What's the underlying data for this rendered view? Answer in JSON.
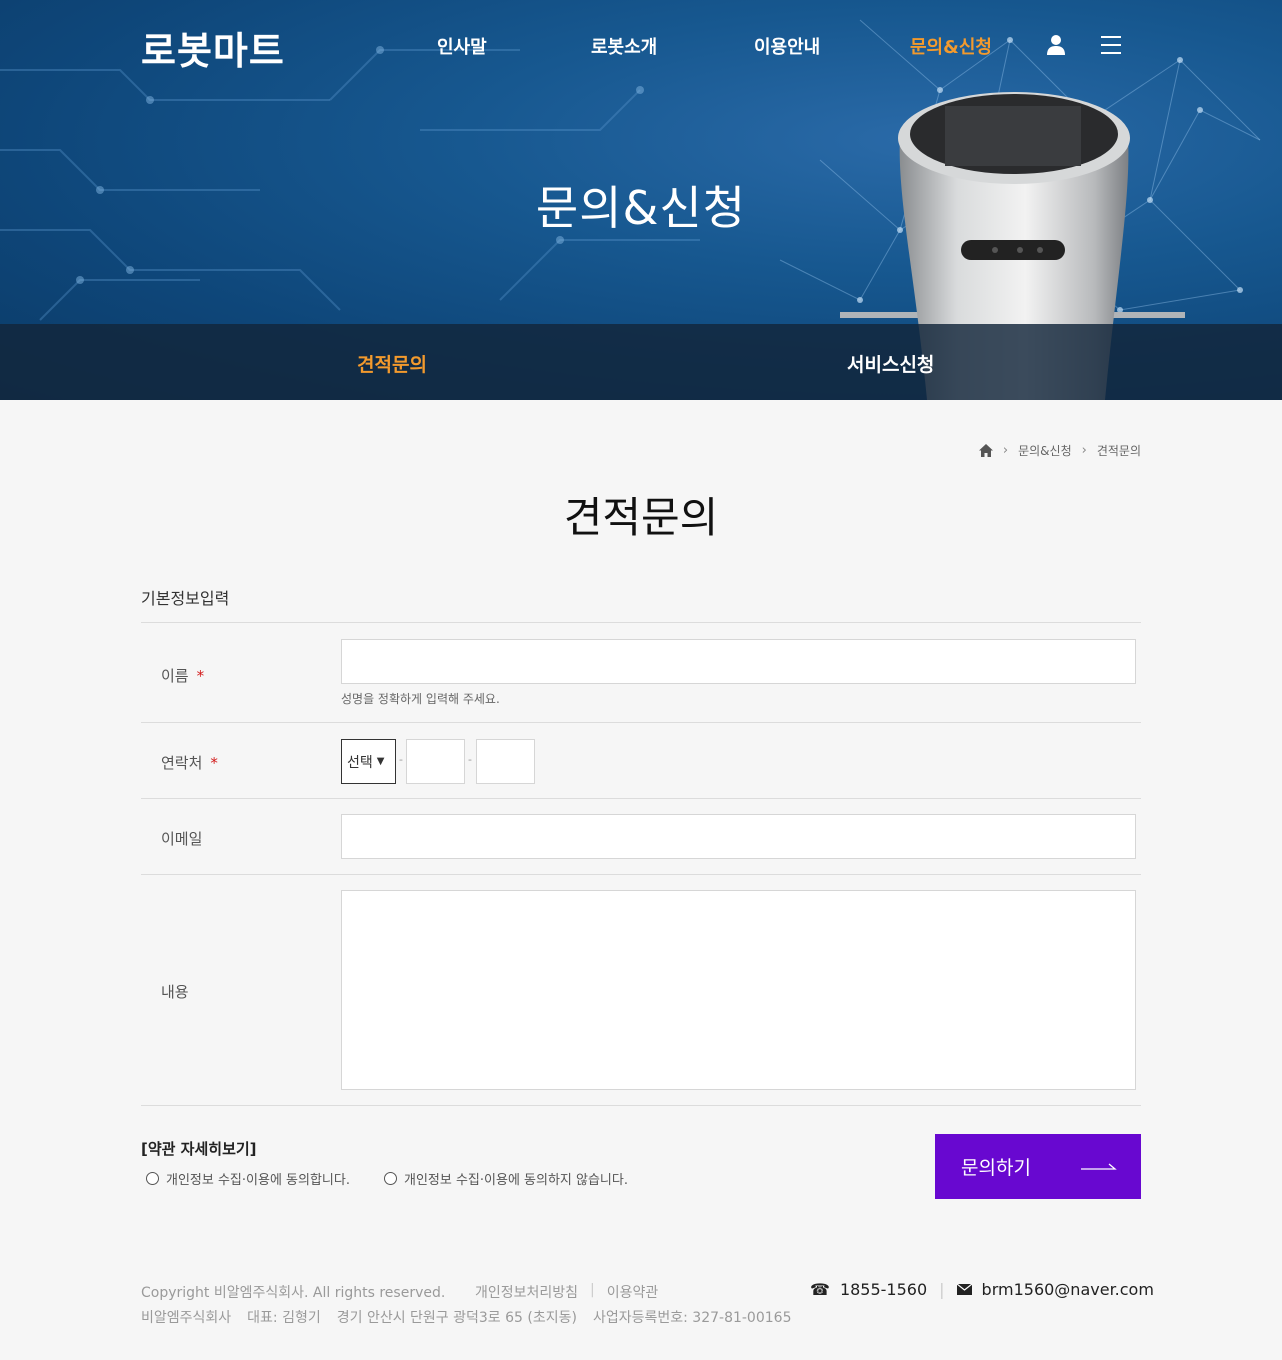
{
  "brand": {
    "logo": "로봇마트",
    "accent": "#f39a2d",
    "button_color": "#6808d0"
  },
  "nav": {
    "items": [
      "인사말",
      "로봇소개",
      "이용안내",
      "문의&신청"
    ],
    "active_index": 3
  },
  "hero": {
    "title": "문의&신청"
  },
  "subnav": {
    "items": [
      "견적문의",
      "서비스신청"
    ],
    "active_index": 0
  },
  "breadcrumb": {
    "items": [
      "문의&신청",
      "견적문의"
    ]
  },
  "page": {
    "title": "견적문의"
  },
  "form": {
    "section_label": "기본정보입력",
    "name_label": "이름",
    "name_required": "*",
    "name_value": "",
    "name_hint": "성명을 정확하게 입력해 주세요.",
    "phone_label": "연락처",
    "phone_required": "*",
    "phone_select": "선택",
    "phone_dash": "-",
    "email_label": "이메일",
    "email_value": "",
    "content_label": "내용",
    "content_value": "",
    "terms_link": "[약관 자세히보기]",
    "agree_yes": "개인정보 수집·이용에 동의합니다.",
    "agree_no": "개인정보 수집·이용에 동의하지 않습니다.",
    "submit": "문의하기"
  },
  "footer": {
    "copyright": "Copyright 비알엠주식회사. All rights reserved.",
    "links": [
      "개인정보처리방침",
      "이용약관"
    ],
    "company": "비알엠주식회사",
    "ceo": "대표: 김형기",
    "address": "경기 안산시 단원구 광덕3로 65 (초지동)",
    "biz_no": "사업자등록번호: 327-81-00165",
    "phone": "1855-1560",
    "email": "brm1560@naver.com"
  }
}
